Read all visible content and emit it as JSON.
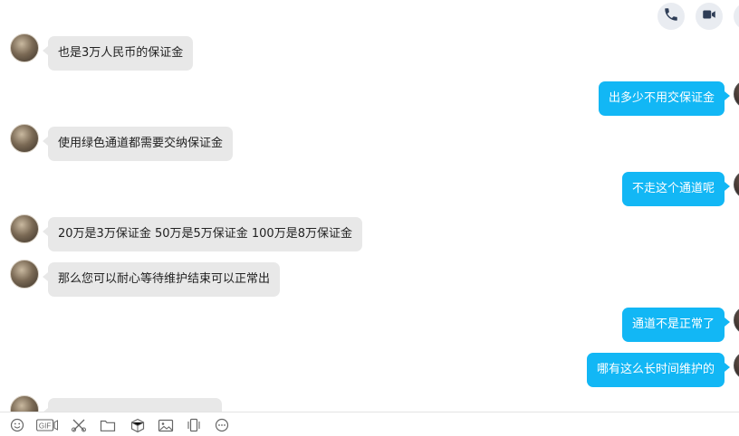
{
  "header": {
    "voice_call_icon": "phone-icon",
    "video_call_icon": "video-camera-icon",
    "accent_color": "#12b7f5"
  },
  "messages": [
    {
      "side": "in",
      "text": "也是3万人民币的保证金"
    },
    {
      "side": "out",
      "text": "出多少不用交保证金"
    },
    {
      "side": "in",
      "text": "使用绿色通道都需要交纳保证金"
    },
    {
      "side": "out",
      "text": "不走这个通道呢"
    },
    {
      "side": "in",
      "text": "20万是3万保证金 50万是5万保证金 100万是8万保证金"
    },
    {
      "side": "in",
      "text": "那么您可以耐心等待维护结束可以正常出"
    },
    {
      "side": "out",
      "text": "通道不是正常了"
    },
    {
      "side": "out",
      "text": "哪有这么长时间维护的"
    },
    {
      "side": "in",
      "text": ""
    }
  ],
  "toolbar": {
    "items": [
      "emoji-icon",
      "gif-icon",
      "scissors-icon",
      "folder-icon",
      "dice-icon",
      "image-icon",
      "shake-icon",
      "more-icon"
    ],
    "gif_label": "GIF"
  }
}
